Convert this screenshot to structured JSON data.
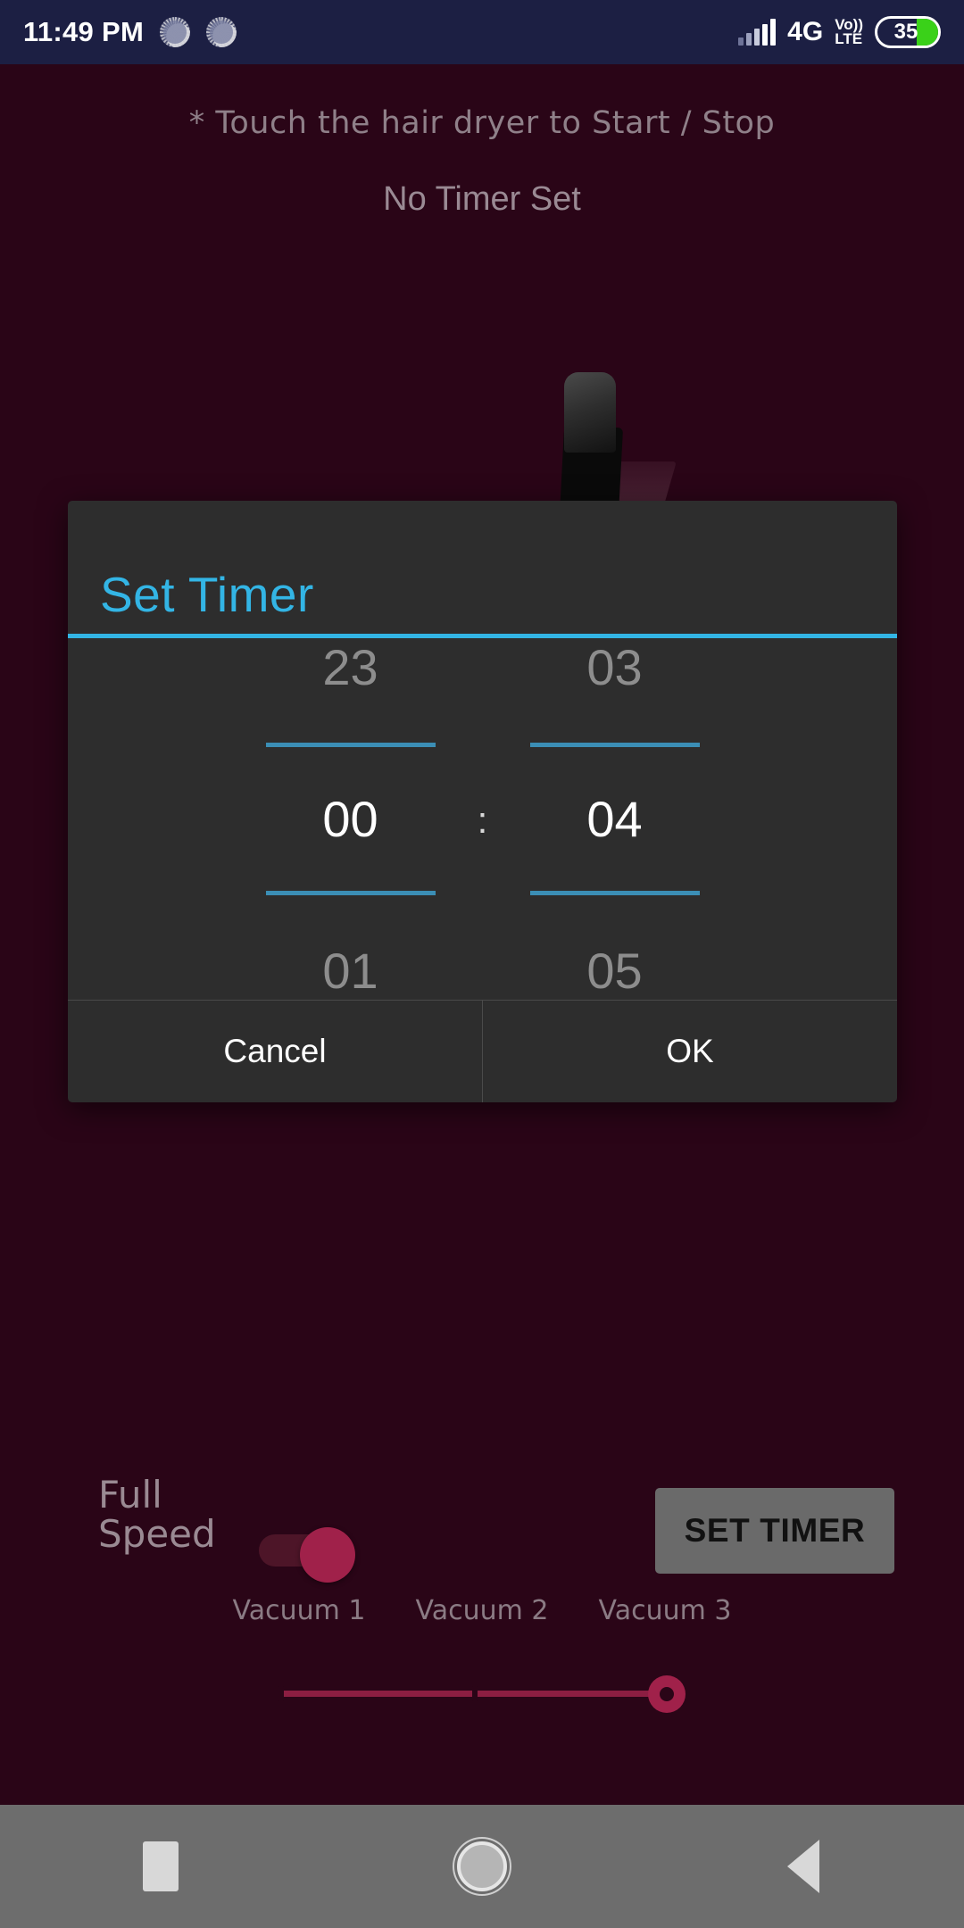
{
  "statusbar": {
    "clock": "11:49 PM",
    "icons": [
      "sync-icon",
      "sync-icon"
    ],
    "network_label": "4G",
    "volte_top": "Vo))",
    "volte_bottom": "LTE",
    "battery_level": "35",
    "battery_percent": 35,
    "bar_color": "#1c1f43",
    "battery_fill_color": "#3ad119"
  },
  "app": {
    "background_color": "#2a0517",
    "hint": "* Touch the hair dryer to Start / Stop",
    "timer_status": "No Timer Set"
  },
  "dialog": {
    "title": "Set Timer",
    "title_color": "#33b5e5",
    "background_color": "#2d2d2d",
    "accent_color": "#33b5e5",
    "hours": {
      "previous": "23",
      "current": "00",
      "next": "01"
    },
    "separator": ":",
    "minutes": {
      "previous": "03",
      "current": "04",
      "next": "05"
    },
    "buttons": {
      "cancel": "Cancel",
      "ok": "OK"
    }
  },
  "controls": {
    "full_speed_line1": "Full",
    "full_speed_line2": "Speed",
    "full_speed_on": true,
    "toggle_color": "#a0214a",
    "set_timer_button": "SET TIMER",
    "vacuum_labels": [
      "Vacuum 1",
      "Vacuum 2",
      "Vacuum 3"
    ],
    "vacuum_selected": "Vacuum 3",
    "slider_color": "#8c1e42"
  },
  "navbar": {
    "background_color": "#6d6d6d",
    "items": [
      "recent-apps",
      "home",
      "back"
    ]
  }
}
